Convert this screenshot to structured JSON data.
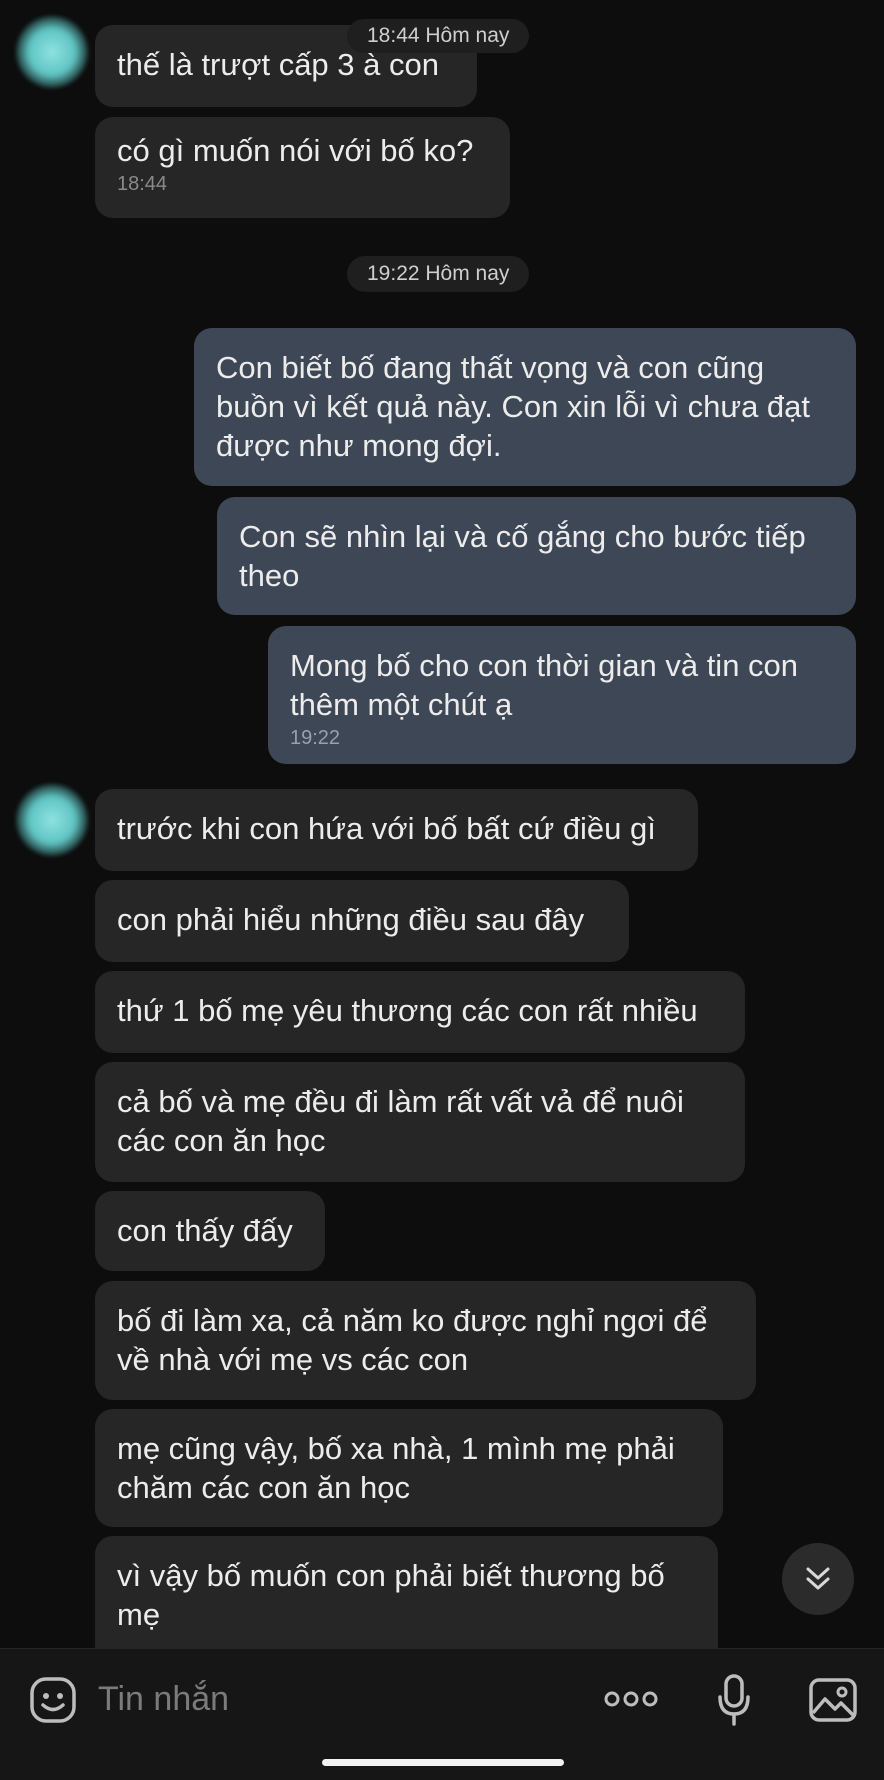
{
  "chat": {
    "date_pills": [
      "18:44 Hôm nay",
      "19:22 Hôm nay"
    ],
    "messages": [
      {
        "side": "in",
        "text": "thế là trượt cấp 3 à con"
      },
      {
        "side": "in",
        "text": "có gì muốn nói với bố ko?",
        "time": "18:44"
      },
      {
        "side": "out",
        "text": "Con biết bố đang thất vọng và con cũng buồn vì kết quả này. Con xin lỗi vì chưa đạt được như mong đợi."
      },
      {
        "side": "out",
        "text": "Con sẽ nhìn lại và cố gắng cho bước tiếp theo"
      },
      {
        "side": "out",
        "text": "Mong bố cho con thời gian và tin con thêm một chút ạ",
        "time": "19:22"
      },
      {
        "side": "in",
        "text": "trước khi con hứa với bố bất cứ điều gì"
      },
      {
        "side": "in",
        "text": "con phải hiểu những điều sau đây"
      },
      {
        "side": "in",
        "text": "thứ 1 bố mẹ yêu thương các con rất nhiều"
      },
      {
        "side": "in",
        "text": "cả bố và mẹ đều đi làm rất vất vả để nuôi các con ăn học"
      },
      {
        "side": "in",
        "text": "con thấy đấy"
      },
      {
        "side": "in",
        "text": "bố đi làm xa, cả năm ko được nghỉ ngơi để về nhà với mẹ vs các con"
      },
      {
        "side": "in",
        "text": "mẹ cũng vậy, bố xa nhà, 1 mình mẹ phải chăm các con ăn học"
      },
      {
        "side": "in",
        "text": "vì vậy bố muốn con phải biết thương bố mẹ"
      }
    ]
  },
  "composer": {
    "placeholder": "Tin nhắn",
    "icons": [
      "emoji-icon",
      "more-icon",
      "microphone-icon",
      "image-icon"
    ]
  },
  "scroll_button_icon": "double-chevron-down-icon",
  "colors": {
    "background": "#0d0d0d",
    "incoming_bubble": "#262626",
    "outgoing_bubble": "#3e4756"
  }
}
